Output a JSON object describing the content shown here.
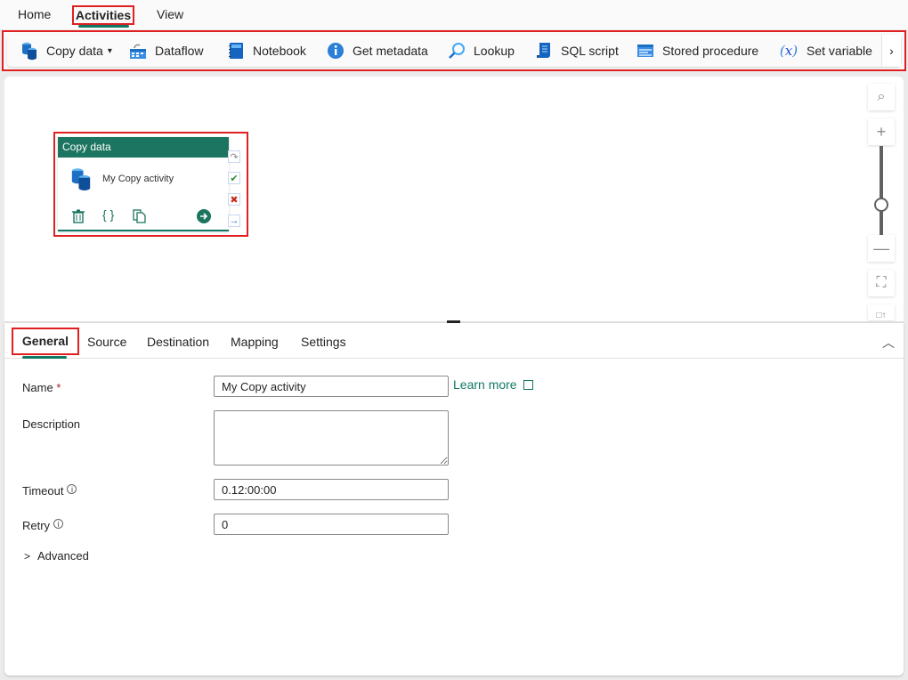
{
  "menu": {
    "tabs": [
      {
        "label": "Home",
        "active": false
      },
      {
        "label": "Activities",
        "active": true
      },
      {
        "label": "View",
        "active": false
      }
    ]
  },
  "toolbar": {
    "items": [
      {
        "label": "Copy data",
        "icon": "copy-data-icon",
        "has_dropdown": true
      },
      {
        "label": "Dataflow",
        "icon": "dataflow-icon"
      },
      {
        "label": "Notebook",
        "icon": "notebook-icon"
      },
      {
        "label": "Get metadata",
        "icon": "info-icon"
      },
      {
        "label": "Lookup",
        "icon": "lookup-icon"
      },
      {
        "label": "SQL script",
        "icon": "sql-script-icon"
      },
      {
        "label": "Stored procedure",
        "icon": "stored-procedure-icon"
      },
      {
        "label": "Set variable",
        "icon": "variable-icon"
      }
    ],
    "more_glyph": "›"
  },
  "canvas": {
    "activity": {
      "type_label": "Copy data",
      "name": "My Copy activity",
      "actions": [
        "delete-icon",
        "code-icon",
        "copy-icon",
        "go-icon"
      ],
      "ports": [
        {
          "name": "skip-port",
          "glyph": "↷",
          "color": "#8a8a8a"
        },
        {
          "name": "success-port",
          "glyph": "✔",
          "color": "#2d8a2d"
        },
        {
          "name": "fail-port",
          "glyph": "✖",
          "color": "#c42b1c"
        },
        {
          "name": "completion-port",
          "glyph": "→",
          "color": "#2a6fd6"
        }
      ]
    },
    "zoom_controls": {
      "search": "⌕",
      "zoom_in": "+",
      "zoom_out": "—",
      "fit": "⛶",
      "auto_align": "□↑"
    },
    "zoom_level_fraction": 0.45
  },
  "panel": {
    "tabs": [
      {
        "label": "General",
        "active": true
      },
      {
        "label": "Source"
      },
      {
        "label": "Destination"
      },
      {
        "label": "Mapping"
      },
      {
        "label": "Settings"
      }
    ],
    "collapse_glyph": "︿",
    "fields": {
      "name": {
        "label": "Name",
        "required_mark": "*",
        "value": "My Copy activity"
      },
      "learn_more": "Learn more",
      "description": {
        "label": "Description",
        "value": ""
      },
      "timeout": {
        "label": "Timeout",
        "value": "0.12:00:00"
      },
      "retry": {
        "label": "Retry",
        "value": "0"
      }
    },
    "advanced_label": "Advanced",
    "info_glyph": "i"
  },
  "colors": {
    "accent": "#117865",
    "highlight": "#e02020",
    "card_header": "#1c7560"
  }
}
